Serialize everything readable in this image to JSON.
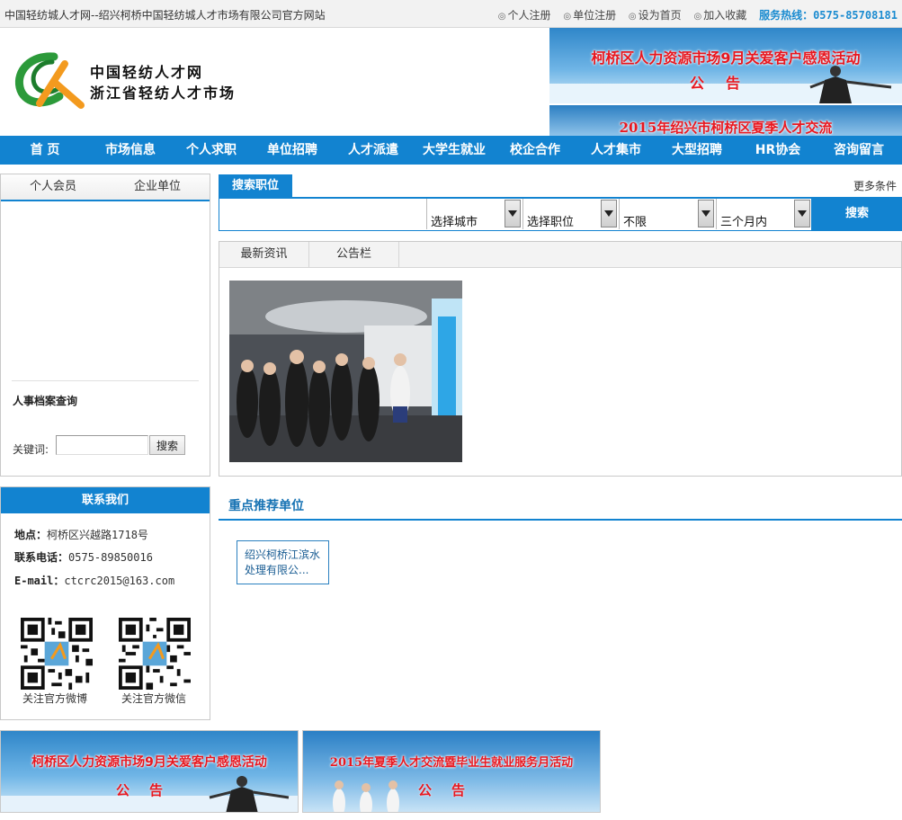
{
  "topbar": {
    "site_title": "中国轻纺城人才网--绍兴柯桥中国轻纺城人才市场有限公司官方网站",
    "links": [
      "个人注册",
      "单位注册",
      "设为首页",
      "加入收藏"
    ],
    "hotline_label": "服务热线：",
    "hotline_number": "0575-85708181"
  },
  "header": {
    "logo_line1": "中国轻纺人才网",
    "logo_line2": "浙江省轻纺人才市场",
    "banner1_title": "柯桥区人力资源市场9月关爱客户感恩活动",
    "banner1_sub": "公告",
    "banner2_title": "2015年绍兴市柯桥区夏季人才交流"
  },
  "nav": [
    "首 页",
    "市场信息",
    "个人求职",
    "单位招聘",
    "人才派遣",
    "大学生就业",
    "校企合作",
    "人才集市",
    "大型招聘",
    "HR协会",
    "咨询留言"
  ],
  "login": {
    "tabs": [
      "个人会员",
      "企业单位"
    ],
    "archive_title": "人事档案查询",
    "keyword_label": "关键词:",
    "search_button": "搜索"
  },
  "contact": {
    "title": "联系我们",
    "address_label": "地点：",
    "address": "柯桥区兴越路1718号",
    "phone_label": "联系电话：",
    "phone": "0575-89850016",
    "email_label": "E-mail：",
    "email": "ctcrc2015@163.com",
    "qr1_caption": "关注官方微博",
    "qr2_caption": "关注官方微信"
  },
  "search": {
    "tab": "搜索职位",
    "more": "更多条件",
    "city": "选择城市",
    "position": "选择职位",
    "limit": "不限",
    "period": "三个月内",
    "button": "搜索"
  },
  "news": {
    "tabs": [
      "最新资讯",
      "公告栏"
    ]
  },
  "recommend": {
    "title": "重点推荐单位",
    "company": "绍兴柯桥江滨水处理有限公..."
  },
  "bottom_banners": {
    "b1_title": "柯桥区人力资源市场9月关爱客户感恩活动",
    "b1_sub": "公告",
    "b2_title": "2015年夏季人才交流暨毕业生就业服务月活动",
    "b2_sub": "公告"
  },
  "colors": {
    "primary": "#1283d0",
    "banner_text": "#e8171f",
    "hotline": "#1a8bd0"
  }
}
